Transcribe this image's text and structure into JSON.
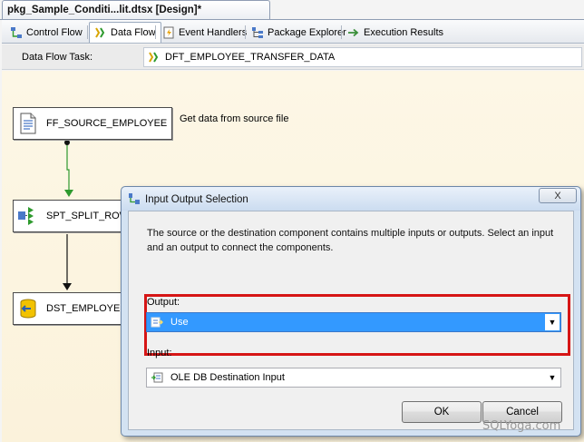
{
  "document_tab": {
    "title": "pkg_Sample_Conditi...lit.dtsx [Design]*"
  },
  "designer_tabs": [
    {
      "label": "Control Flow",
      "icon": "control-flow-icon"
    },
    {
      "label": "Data Flow",
      "icon": "data-flow-icon",
      "active": true
    },
    {
      "label": "Event Handlers",
      "icon": "event-handlers-icon"
    },
    {
      "label": "Package Explorer",
      "icon": "package-explorer-icon"
    },
    {
      "label": "Execution Results",
      "icon": "execution-results-icon"
    }
  ],
  "task_bar": {
    "label": "Data Flow Task:",
    "selected_task": "DFT_EMPLOYEE_TRANSFER_DATA"
  },
  "canvas": {
    "components": [
      {
        "name": "FF_SOURCE_EMPLOYEE",
        "icon": "flat-file-source-icon"
      },
      {
        "name": "SPT_SPLIT_ROW",
        "icon": "conditional-split-icon"
      },
      {
        "name": "DST_EMPLOYEE",
        "icon": "ole-db-destination-icon"
      }
    ],
    "annotation": "Get data from source file"
  },
  "dialog": {
    "title": "Input Output Selection",
    "close_label": "X",
    "message": "The source or the destination component contains multiple inputs or outputs. Select an input and an output to connect the components.",
    "output_label": "Output:",
    "output_value": "Use",
    "input_label": "Input:",
    "input_value": "OLE DB Destination Input",
    "ok_label": "OK",
    "cancel_label": "Cancel"
  },
  "watermark": "SQLYoga.com",
  "colors": {
    "highlight": "#d61515",
    "selection": "#3399ff",
    "canvas": "#fbf2db",
    "connector": "#2e9a2e"
  }
}
